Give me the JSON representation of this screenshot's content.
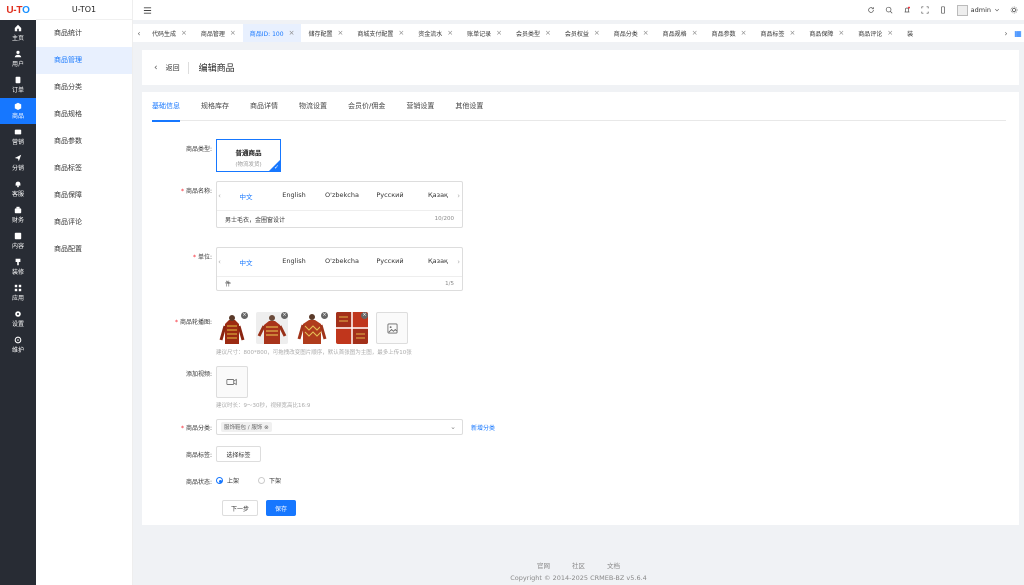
{
  "logo": {
    "text_a": "U-T",
    "text_b": "O"
  },
  "nav": [
    {
      "label": "主页",
      "icon": "home-icon"
    },
    {
      "label": "用户",
      "icon": "user-icon"
    },
    {
      "label": "订单",
      "icon": "order-icon"
    },
    {
      "label": "商品",
      "icon": "product-icon",
      "active": true
    },
    {
      "label": "营销",
      "icon": "marketing-icon"
    },
    {
      "label": "分销",
      "icon": "distribution-icon"
    },
    {
      "label": "客服",
      "icon": "service-icon"
    },
    {
      "label": "财务",
      "icon": "finance-icon"
    },
    {
      "label": "内容",
      "icon": "content-icon"
    },
    {
      "label": "装修",
      "icon": "decorate-icon"
    },
    {
      "label": "应用",
      "icon": "apps-icon"
    },
    {
      "label": "设置",
      "icon": "gear-icon"
    },
    {
      "label": "维护",
      "icon": "maintain-icon"
    }
  ],
  "submenu": {
    "title": "U-TO1",
    "items": [
      "商品统计",
      "商品管理",
      "商品分类",
      "商品规格",
      "商品参数",
      "商品标签",
      "商品保障",
      "商品评论",
      "商品配置"
    ],
    "active_index": 1
  },
  "topbar": {
    "menu_icon": "menu-fold-icon",
    "user": "admin"
  },
  "tabs": [
    {
      "label": "代码生成"
    },
    {
      "label": "商品管理"
    },
    {
      "label": "商品ID: 100",
      "active": true
    },
    {
      "label": "储存配置"
    },
    {
      "label": "商城支付配置"
    },
    {
      "label": "资金流水"
    },
    {
      "label": "账单记录"
    },
    {
      "label": "会员类型"
    },
    {
      "label": "会员权益"
    },
    {
      "label": "商品分类"
    },
    {
      "label": "商品规格"
    },
    {
      "label": "商品参数"
    },
    {
      "label": "商品标签"
    },
    {
      "label": "商品保障"
    },
    {
      "label": "商品评论"
    },
    {
      "label": "装"
    }
  ],
  "header": {
    "back": "返回",
    "title": "编辑商品"
  },
  "form_tabs": [
    "基础信息",
    "规格库存",
    "商品详情",
    "物流设置",
    "会员价/佣金",
    "营销设置",
    "其他设置"
  ],
  "form": {
    "type_label": "商品类型:",
    "type_name": "普通商品",
    "type_sub": "(物流发货)",
    "name_label": "商品名称:",
    "languages": [
      "中文",
      "English",
      "O'zbekcha",
      "Русский",
      "Қазақ"
    ],
    "name_value": "男士毛衣，金圈窗设计",
    "name_count": "10/200",
    "unit_label": "单位:",
    "unit_value": "件",
    "unit_count": "1/5",
    "images_label": "商品轮播图:",
    "images_tip": "建议尺寸：800*800，可拖拽改变图片顺序，默认首张图为主图，最多上传10张",
    "video_label": "添加视频:",
    "video_tip": "建议时长：9～30秒，视频宽高比16:9",
    "category_label": "商品分类:",
    "category_chip": "服饰鞋包 / 服饰",
    "category_new": "新增分类",
    "tags_label": "商品标签:",
    "tags_button": "选择标签",
    "status_label": "商品状态:",
    "status_on": "上架",
    "status_off": "下架",
    "next_button": "下一步",
    "save_button": "保存"
  },
  "footer": {
    "links": [
      "官网",
      "社区",
      "文档"
    ],
    "copyright": "Copyright © 2014-2025 CRMEB-BZ v5.6.4"
  },
  "colors": {
    "accent": "#1677ff",
    "sidebar": "#282c34",
    "required": "#f5222d"
  }
}
